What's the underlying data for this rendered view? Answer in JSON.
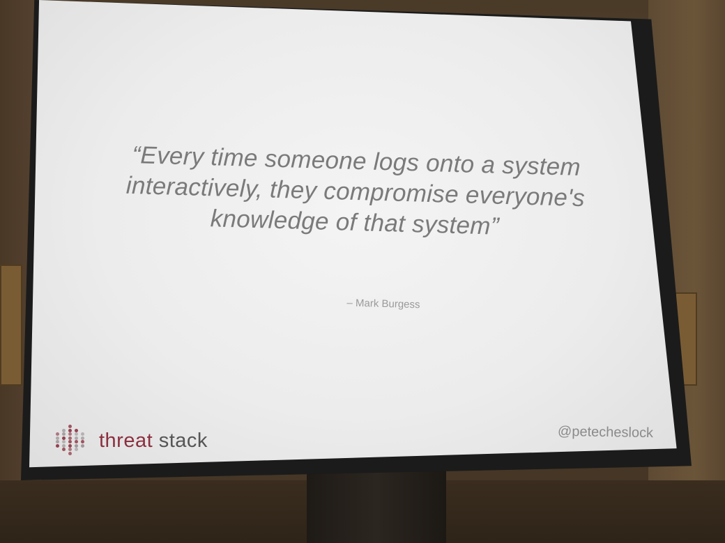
{
  "slide": {
    "quote_lines": [
      "“Every time someone logs onto a system",
      "interactively, they compromise everyone's",
      "knowledge of that system”"
    ],
    "attribution": "– Mark Burgess",
    "logo": {
      "word1": "threat",
      "word2": "stack",
      "icon": "threat-stack-dots-icon",
      "color_word1": "#8b2f3f",
      "color_word2": "#555555"
    },
    "handle": "@petecheslock"
  }
}
